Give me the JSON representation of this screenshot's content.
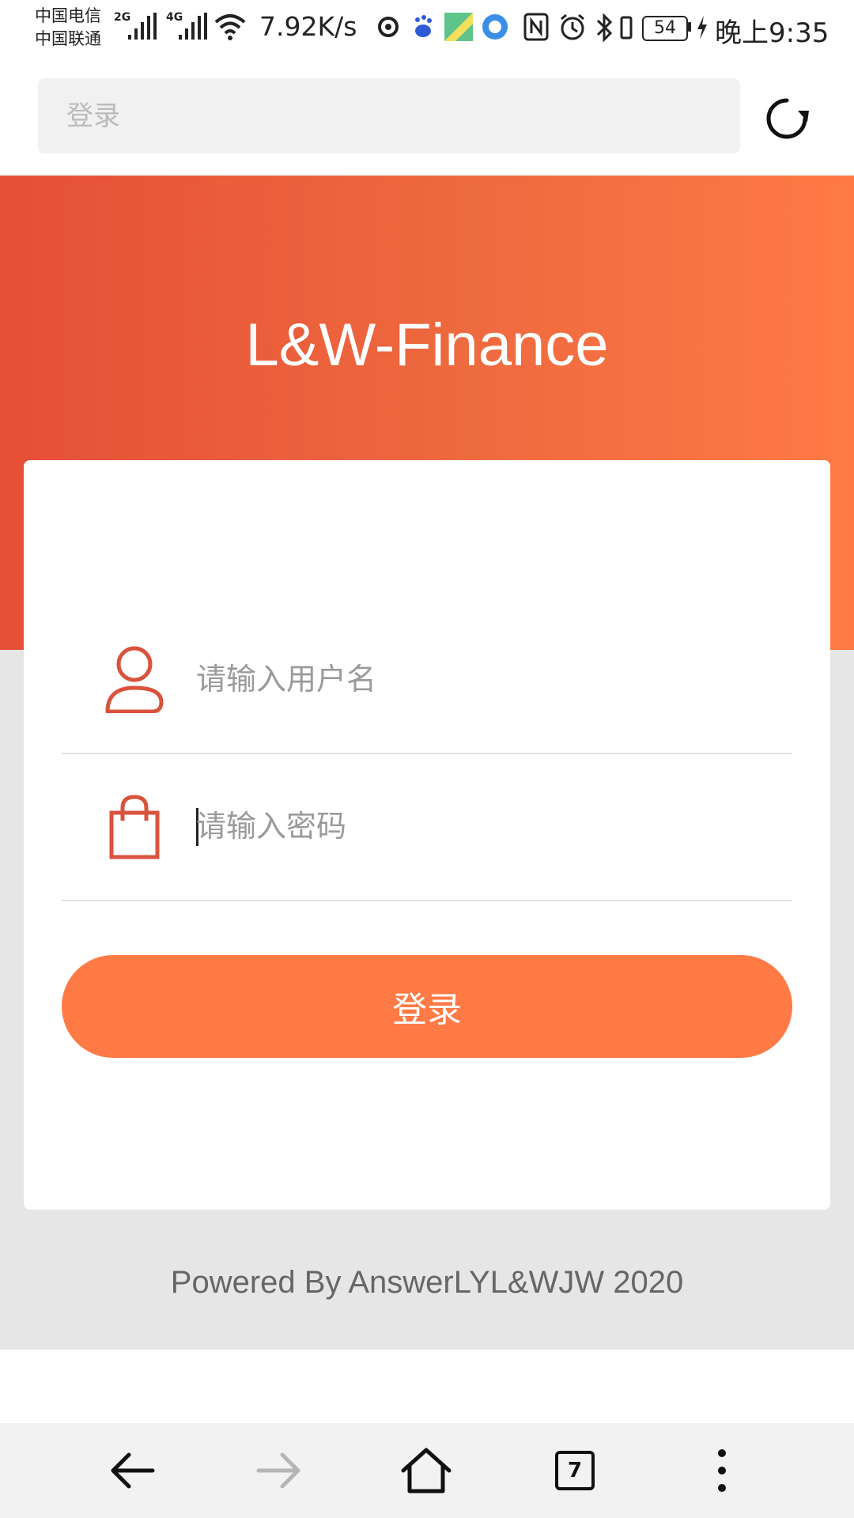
{
  "status_bar": {
    "carrier_1": "中国电信",
    "carrier_2": "中国联通",
    "signal_1_label": "2G",
    "signal_2_label": "4G",
    "net_speed": "7.92K/s",
    "battery_level": "54",
    "time": "晚上9:35",
    "icons": [
      "netease-music-icon",
      "baidu-icon",
      "maps-icon",
      "browser-icon",
      "nfc-icon",
      "alarm-icon",
      "bluetooth-icon",
      "vibrate-icon",
      "charging-icon"
    ]
  },
  "browser": {
    "url_placeholder": "登录",
    "reload_icon": "reload-icon",
    "tab_count": "7"
  },
  "page": {
    "title": "L&W-Finance",
    "username_placeholder": "请输入用户名",
    "password_placeholder": "请输入密码",
    "login_button_label": "登录",
    "footer": "Powered By AnswerLYL&WJW 2020"
  },
  "colors": {
    "hero_gradient_start": "#e64f36",
    "hero_gradient_end": "#ff7a45",
    "button": "#ff7a45",
    "icon_stroke": "#d9533c",
    "page_background": "#e6e6e6"
  }
}
